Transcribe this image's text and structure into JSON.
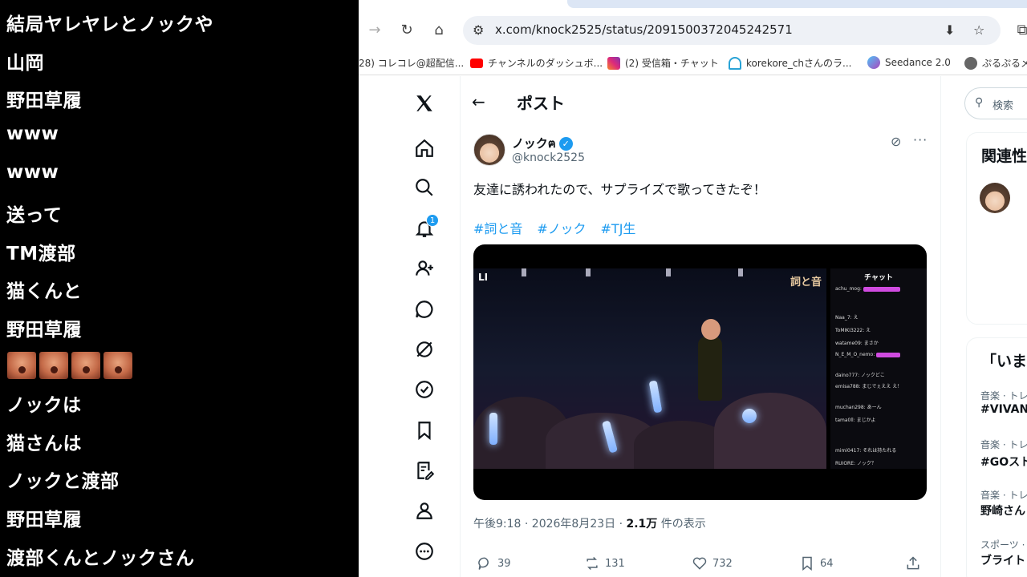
{
  "chat": {
    "lines": [
      "結局ヤレヤレとノックや",
      "山岡",
      "野田草履",
      "www",
      "www",
      "送って",
      "TM渡部",
      "猫くんと",
      "野田草履",
      "",
      "ノックは",
      "猫さんは",
      "ノックと渡部",
      "野田草履",
      "渡部くんとノックさん"
    ]
  },
  "browser": {
    "url": "x.com/knock2525/status/2091500372045242571",
    "bookmarks": [
      "28) コレコレ@超配信...",
      "チャンネルのダッシュボ...",
      "(2) 受信箱・チャット",
      "korekore_chさんのラ...",
      "Seedance 2.0",
      "ぷるぷるメー"
    ]
  },
  "post": {
    "header_title": "ポスト",
    "author_name": "ノックฅ",
    "author_handle": "@knock2525",
    "text": "友達に誘われたので、サプライズで歌ってきたぞ！",
    "hashtags": [
      "#詞と音",
      "#ノック",
      "#TJ生"
    ],
    "meta_time": "午後9:18 · 2026年8月23日 · ",
    "meta_views": "2.1万",
    "meta_views_suffix": " 件の表示",
    "replies": "39",
    "reposts": "131",
    "likes": "732",
    "bookmarks": "64",
    "notification_badge": "1"
  },
  "video": {
    "logo_left": "LI",
    "logo_right": "詞と音",
    "chat_title": "チャット",
    "chat_lines": [
      "achu_mog:",
      "Naa_7: え",
      "ToMIKI3222: え",
      "watame09: まさか",
      "N_E_M_O_nemo:",
      "daino777: ノックどこ",
      "emisa788: まじでぇええ え！",
      "muchan298: あーん",
      "tama0ll: まじかよ",
      "mimi0417: それは持たれる",
      "RUIORE: ノック？"
    ]
  },
  "sidebar": {
    "search_placeholder": "検索",
    "related_title": "関連性",
    "trend_title": "「いま",
    "trends": [
      {
        "category": "音楽 · トレ",
        "name": "#VIVANT"
      },
      {
        "category": "音楽 · トレ",
        "name": "#GOスト"
      },
      {
        "category": "音楽 · トレ",
        "name": "野崎さん"
      },
      {
        "category": "スポーツ · ト",
        "name": "ブライト"
      }
    ]
  }
}
